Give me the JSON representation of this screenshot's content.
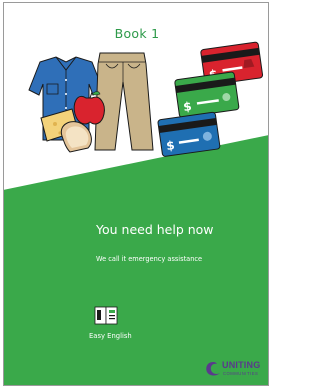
{
  "cover": {
    "book_label": "Book 1",
    "headline": "You need help now",
    "subline": "We call it emergency assistance",
    "easy_english_label": "Easy English"
  },
  "logo": {
    "name_line_1": "UNITING",
    "name_line_2": "COMMUNITIES"
  },
  "icons": {
    "clothes": "clothes-illustration",
    "food": "food-illustration",
    "cards": "bank-cards-illustration",
    "easy_english": "open-book-icon",
    "logo_mark": "uniting-communities-logo-icon"
  },
  "colors": {
    "brand_green": "#3aa94a",
    "text_green": "#2e9a4a",
    "logo_purple": "#5a3a8c",
    "card_red": "#d9232e",
    "card_green": "#3aa94a",
    "card_blue": "#1f6fb2",
    "shirt_blue": "#2f6fb8",
    "trousers_tan": "#c9b48a",
    "apple_red": "#d9232e"
  }
}
